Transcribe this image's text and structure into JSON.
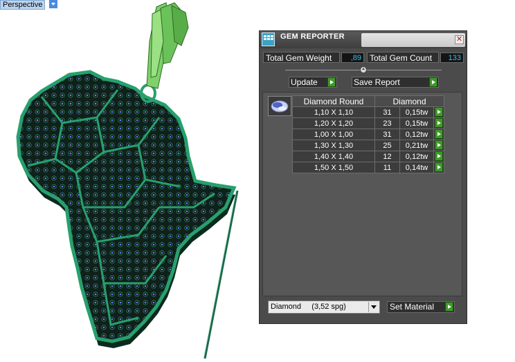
{
  "viewport": {
    "label": "Perspective"
  },
  "panel": {
    "title": "GEM REPORTER",
    "icon": "gem-reporter-icon",
    "total_gem_weight_label": "Total Gem Weight",
    "total_gem_weight_value": ",89",
    "total_gem_count_label": "Total Gem Count",
    "total_gem_count_value": "133",
    "update_label": "Update",
    "save_report_label": "Save Report",
    "table": {
      "headers": {
        "shape": "Diamond Round",
        "material": "Diamond"
      },
      "rows": [
        {
          "size": "1,10 X 1,10",
          "count": "31",
          "weight": "0,15tw"
        },
        {
          "size": "1,20 X 1,20",
          "count": "23",
          "weight": "0,15tw"
        },
        {
          "size": "1,00 X 1,00",
          "count": "31",
          "weight": "0,12tw"
        },
        {
          "size": "1,30 X 1,30",
          "count": "25",
          "weight": "0,21tw"
        },
        {
          "size": "1,40 X 1,40",
          "count": "12",
          "weight": "0,12tw"
        },
        {
          "size": "1,50 X 1,50",
          "count": "11",
          "weight": "0,14tw"
        }
      ]
    },
    "material_select": "Diamond     (3,52 spg)",
    "set_material_label": "Set Material"
  },
  "colors": {
    "panel_bg": "#4b4b4b",
    "value_text": "#39c0e8",
    "go_button": "#3f9a2b",
    "model_green": "#1f8a5a",
    "bail_green": "#7fd16b"
  }
}
